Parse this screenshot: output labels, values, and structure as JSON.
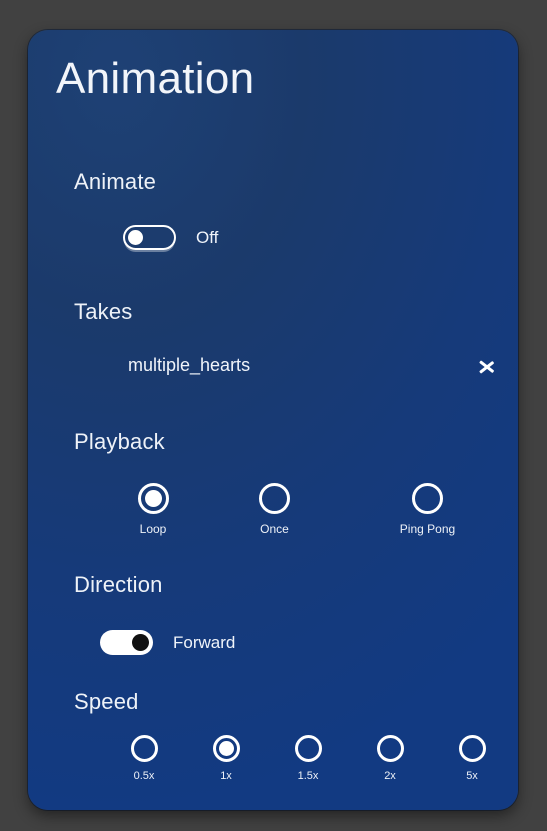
{
  "panel": {
    "title": "Animation",
    "background_color": "#163a7a",
    "page_background_color": "#414141"
  },
  "animate": {
    "heading": "Animate",
    "toggle_state": "off",
    "toggle_label": "Off"
  },
  "takes": {
    "heading": "Takes",
    "value": "multiple_hearts",
    "chevron_icon": "chevron-right-icon"
  },
  "playback": {
    "heading": "Playback",
    "selected": "Loop",
    "options": [
      {
        "label": "Loop",
        "selected": true
      },
      {
        "label": "Once",
        "selected": false
      },
      {
        "label": "Ping Pong",
        "selected": false
      }
    ]
  },
  "direction": {
    "heading": "Direction",
    "toggle_state": "on",
    "toggle_label": "Forward"
  },
  "speed": {
    "heading": "Speed",
    "selected": "1x",
    "options": [
      {
        "label": "0.5x",
        "selected": false
      },
      {
        "label": "1x",
        "selected": true
      },
      {
        "label": "1.5x",
        "selected": false
      },
      {
        "label": "2x",
        "selected": false
      },
      {
        "label": "5x",
        "selected": false
      }
    ]
  }
}
